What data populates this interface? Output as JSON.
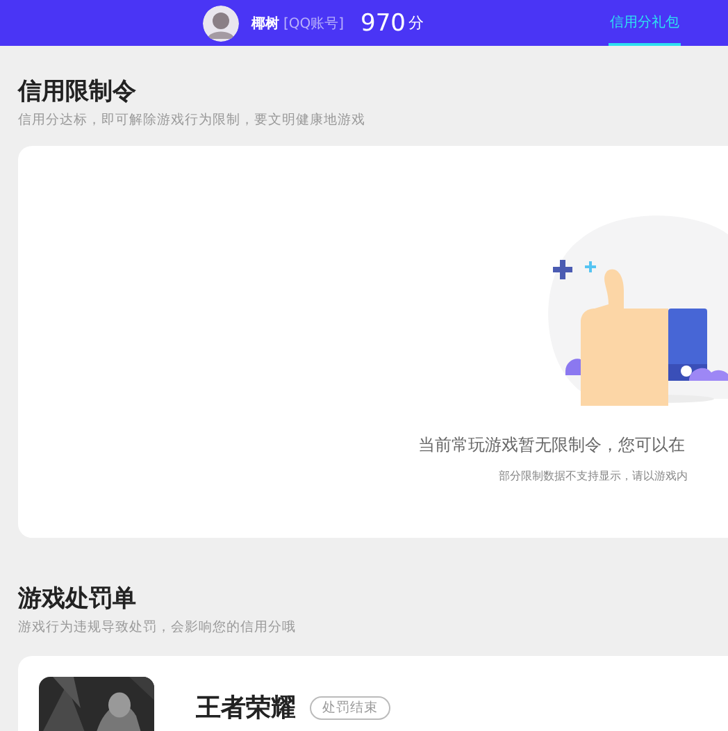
{
  "header": {
    "nickname": "椰树",
    "account_type": "[QQ账号]",
    "score": "970",
    "score_unit": "分",
    "tabs": [
      {
        "label": "信用分礼包",
        "selected": true
      }
    ]
  },
  "restriction": {
    "title": "信用限制令",
    "subtitle": "信用分达标，即可解除游戏行为限制，要文明健康地游戏",
    "empty_message": "当前常玩游戏暂无限制令，您可以在",
    "note": "部分限制数据不支持显示，请以游戏内"
  },
  "penalties": {
    "title": "游戏处罚单",
    "subtitle": "游戏行为违规导致处罚，会影响您的信用分哦",
    "items": [
      {
        "game": "王者荣耀",
        "status": "处罚结束"
      }
    ]
  }
}
